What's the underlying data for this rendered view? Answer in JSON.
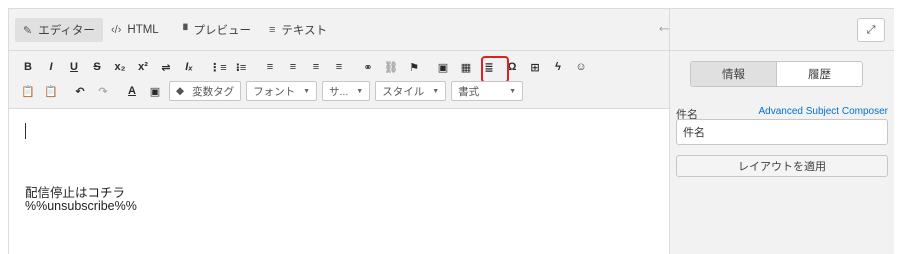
{
  "tabs": [
    {
      "icon": "✎",
      "label": "エディター",
      "active": true
    },
    {
      "icon": "‹/›",
      "label": "HTML"
    },
    {
      "icon": "▝",
      "label": "プレビュー"
    },
    {
      "icon": "≡",
      "label": "テキスト"
    }
  ],
  "toolbar": {
    "row1": [
      "B",
      "I",
      "U",
      "S",
      "x₂",
      "x²",
      "⇌",
      "Iₓ",
      "⋮≡",
      "⁝≡",
      "≡",
      "≡",
      "≡",
      "≡",
      "⚭",
      "⛓",
      "⚑",
      "▣",
      "▦",
      "≣",
      "Ω",
      "⊞",
      "ϟ",
      "☺"
    ],
    "row2_icons": [
      "📋",
      "📋",
      "↶",
      "↷",
      "A",
      "▣"
    ],
    "variable_tag": "変数タグ",
    "font": "フォント",
    "size": "サ...",
    "style": "スタイル",
    "format": "書式"
  },
  "editor": {
    "line1": "配信停止はコチラ",
    "line2": "%%unsubscribe%%"
  },
  "right_panel": {
    "tabs": [
      "情報",
      "履歴"
    ],
    "subject_label": "件名",
    "advanced_link": "Advanced Subject Composer",
    "subject_value": "件名",
    "apply_layout": "レイアウトを適用"
  },
  "accent_colors": {
    "link": "#0070d2",
    "highlight": "#e0201c"
  }
}
